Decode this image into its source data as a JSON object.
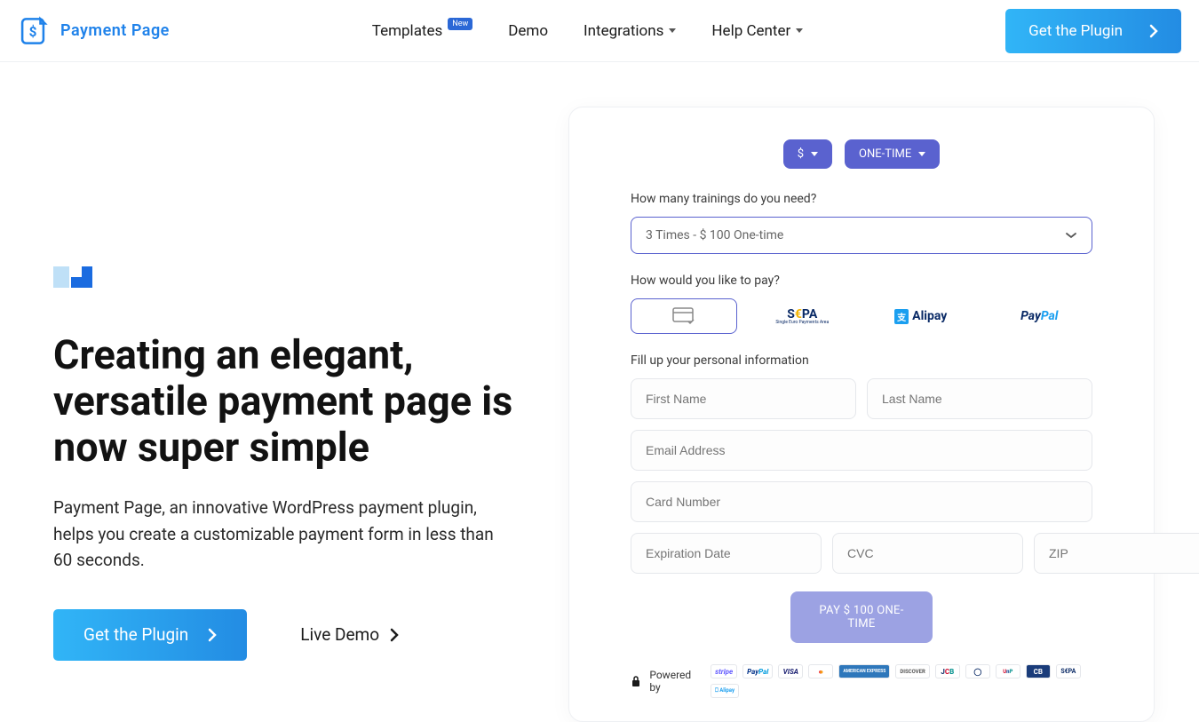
{
  "header": {
    "logo_text": "Payment Page",
    "nav": {
      "templates": "Templates",
      "templates_badge": "New",
      "demo": "Demo",
      "integrations": "Integrations",
      "help_center": "Help Center"
    },
    "cta_label": "Get the Plugin"
  },
  "hero": {
    "headline": "Creating an elegant, versatile payment page is now super simple",
    "subtext": "Payment Page, an innovative WordPress payment plugin, helps you create a customizable payment form in less than 60 seconds.",
    "primary_btn": "Get the Plugin",
    "secondary_btn": "Live Demo"
  },
  "form": {
    "currency_pill": "$",
    "frequency_pill": "ONE-TIME",
    "q1_label": "How many trainings do you need?",
    "q1_value": "3 Times - $ 100 One-time",
    "q2_label": "How would you like to pay?",
    "methods": {
      "sepa": "SEPA",
      "sepa_euro": "€",
      "sepa_sub": "Single Euro Payments Area",
      "alipay": "Alipay",
      "alipay_mark": "支",
      "paypal_a": "Pay",
      "paypal_b": "Pal"
    },
    "personal_label": "Fill up your personal information",
    "placeholders": {
      "first_name": "First Name",
      "last_name": "Last Name",
      "email": "Email Address",
      "card": "Card Number",
      "exp": "Expiration Date",
      "cvc": "CVC",
      "zip": "ZIP"
    },
    "submit_label": "PAY $ 100 ONE-TIME",
    "powered_by": "Powered by",
    "brands": {
      "stripe": "stripe",
      "paypal_a": "Pay",
      "paypal_b": "Pal",
      "visa": "VISA",
      "amex": "AMERICAN EXPRESS",
      "discover": "DISCOVER",
      "jcb_j": "J",
      "jcb_c": "C",
      "jcb_b": "B",
      "diners": "◯",
      "up_u": "U",
      "up_n": "n",
      "up_p": "P",
      "cb": "CB",
      "sepa": "S€PA",
      "alipay": "⎕ Alipay"
    }
  }
}
